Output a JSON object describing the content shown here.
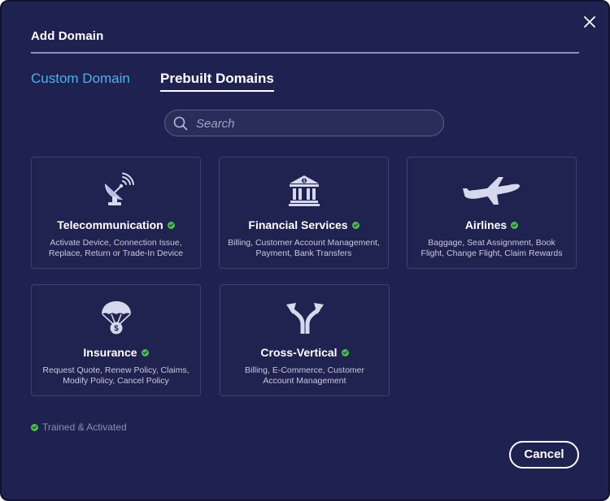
{
  "dialog": {
    "title": "Add Domain",
    "close_icon": "close-icon"
  },
  "tabs": [
    {
      "label": "Custom Domain",
      "active": false
    },
    {
      "label": "Prebuilt Domains",
      "active": true
    }
  ],
  "search": {
    "placeholder": "Search",
    "value": "",
    "icon": "search-icon"
  },
  "domains": [
    {
      "name": "Telecommunication",
      "icon": "satellite-dish-icon",
      "status": "trained-activated",
      "description": "Activate Device, Connection Issue, Replace, Return or Trade-In Device"
    },
    {
      "name": "Financial Services",
      "icon": "bank-icon",
      "status": "trained-activated",
      "description": "Billing, Customer Account Management, Payment, Bank Transfers"
    },
    {
      "name": "Airlines",
      "icon": "airplane-icon",
      "status": "trained-activated",
      "description": "Baggage, Seat Assignment, Book Flight, Change Flight, Claim Rewards"
    },
    {
      "name": "Insurance",
      "icon": "parachute-money-icon",
      "status": "trained-activated",
      "description": "Request Quote, Renew Policy, Claims, Modify Policy, Cancel Policy"
    },
    {
      "name": "Cross-Vertical",
      "icon": "split-arrows-icon",
      "status": "trained-activated",
      "description": "Billing, E-Commerce, Customer Account Management"
    }
  ],
  "legend": {
    "label": "Trained & Activated"
  },
  "footer": {
    "cancel_label": "Cancel"
  },
  "colors": {
    "background": "#1f2150",
    "accent_tab": "#49b4ec",
    "status_green": "#47c04a",
    "icon": "#d6d8ee"
  }
}
